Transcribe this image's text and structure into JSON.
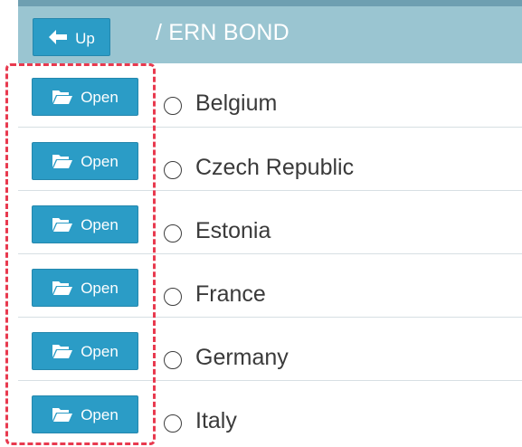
{
  "header": {
    "up_label": "Up",
    "path": "/ ERN BOND"
  },
  "rows": [
    {
      "button_label": "Open",
      "name": "Belgium"
    },
    {
      "button_label": "Open",
      "name": "Czech Republic"
    },
    {
      "button_label": "Open",
      "name": "Estonia"
    },
    {
      "button_label": "Open",
      "name": "France"
    },
    {
      "button_label": "Open",
      "name": "Germany"
    },
    {
      "button_label": "Open",
      "name": "Italy"
    }
  ],
  "icons": {
    "up": "arrow-left-icon",
    "open": "folder-open-icon"
  },
  "colors": {
    "button": "#2b9cc6",
    "header": "#9ac5d1",
    "highlight": "#e83a4f"
  }
}
